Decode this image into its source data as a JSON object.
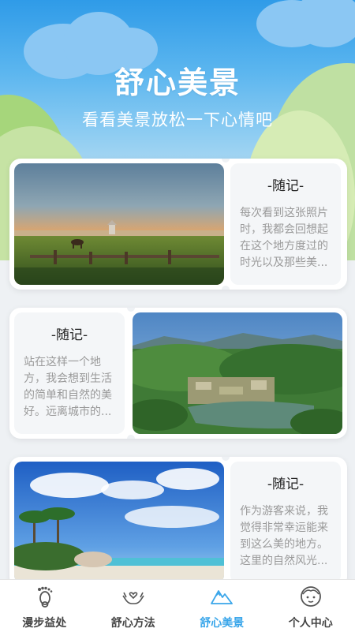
{
  "header": {
    "title": "舒心美景",
    "subtitle": "看看美景放松一下心情吧"
  },
  "cards": [
    {
      "note_title": "-随记-",
      "note_text": "每次看到这张照片时，我都会回想起在这个地方度过的时光以及那些美...",
      "photo": "sunset-meadow-photo"
    },
    {
      "note_title": "-随记-",
      "note_text": "站在这样一个地方，我会想到生活的简单和自然的美好。远离城市的...",
      "photo": "green-valley-lake-photo"
    },
    {
      "note_title": "-随记-",
      "note_text": "作为游客来说，我觉得非常幸运能来到这么美的地方。这里的自然风光...",
      "photo": "tropical-beach-photo"
    }
  ],
  "tabbar": {
    "items": [
      {
        "label": "漫步益处",
        "icon": "footprint-icon",
        "active": false
      },
      {
        "label": "舒心方法",
        "icon": "hands-heart-icon",
        "active": false
      },
      {
        "label": "舒心美景",
        "icon": "mountain-icon",
        "active": true
      },
      {
        "label": "个人中心",
        "icon": "smiley-face-icon",
        "active": false
      }
    ]
  },
  "colors": {
    "accent": "#3aa6ea",
    "sky_top": "#2f9be8",
    "background": "#eef1f4"
  }
}
